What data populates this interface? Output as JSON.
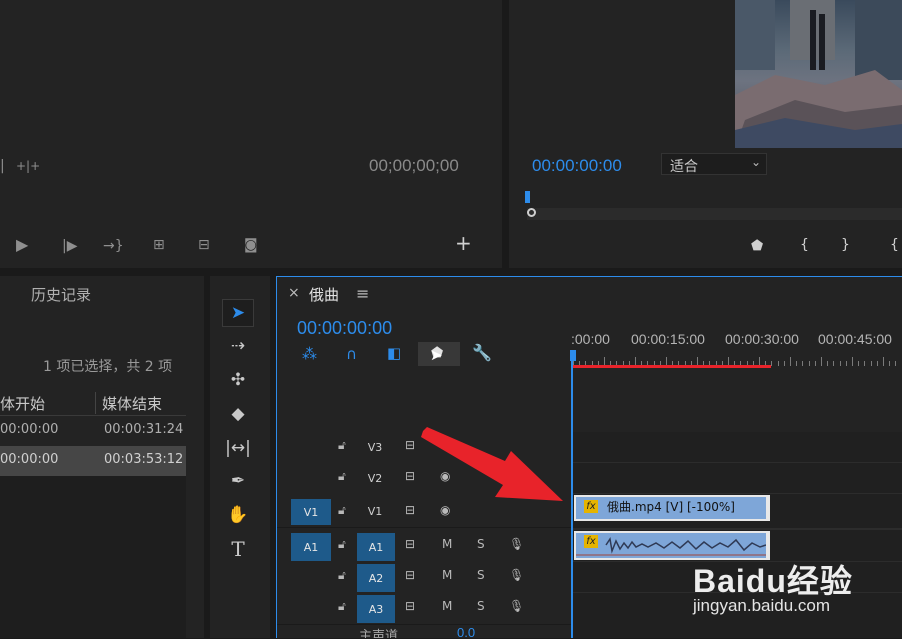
{
  "source_monitor": {
    "timecode": "00;00;00;00",
    "transport_icons": [
      "step-back-icon",
      "play-icon",
      "step-forward-icon",
      "go-to-out-icon",
      "insert-icon",
      "overwrite-icon",
      "export-frame-icon",
      "add-button-icon"
    ]
  },
  "program_monitor": {
    "timecode": "00:00:00:00",
    "fit_select": "适合",
    "marker_icons": [
      "marker-icon",
      "mark-in-icon",
      "mark-out-icon",
      "go-to-in-icon"
    ]
  },
  "project_panel": {
    "tab_history": "历史记录",
    "selection_status": "1 项已选择，共 2 项",
    "columns": [
      "体开始",
      "媒体结束"
    ],
    "rows": [
      {
        "start": "00:00:00",
        "end": "00:00:31:24"
      },
      {
        "start": "00:00:00",
        "end": "00:03:53:12"
      }
    ]
  },
  "tools": [
    "selection-tool",
    "track-select-tool",
    "ripple-edit-tool",
    "razor-tool",
    "slip-tool",
    "pen-tool",
    "hand-tool",
    "type-tool"
  ],
  "timeline": {
    "close": "×",
    "sequence_name": "俄曲",
    "menu": "≡",
    "timecode": "00:00:00:00",
    "ruler_labels": [
      ":00:00",
      "00:00:15:00",
      "00:00:30:00",
      "00:00:45:00"
    ],
    "tracks": [
      {
        "id": "V3",
        "target": "",
        "kind": "video",
        "visible": false
      },
      {
        "id": "V2",
        "target": "",
        "kind": "video",
        "visible": true
      },
      {
        "id": "V1",
        "target": "V1",
        "kind": "video",
        "visible": true
      },
      {
        "id": "A1",
        "target": "A1",
        "kind": "audio"
      },
      {
        "id": "A2",
        "target": "",
        "kind": "audio"
      },
      {
        "id": "A3",
        "target": "",
        "kind": "audio"
      }
    ],
    "mute_label": "M",
    "solo_label": "S",
    "master_label": "主声道",
    "master_value": "0.0",
    "video_clip": {
      "fx": "fx",
      "label": "俄曲.mp4 [V] [-100%]"
    },
    "audio_clip": {
      "fx": "fx"
    }
  },
  "watermark": {
    "brand": "Baidu经验",
    "url": "jingyan.baidu.com"
  },
  "colors": {
    "accent_blue": "#2d8ceb",
    "arrow_red": "#e8232a",
    "clip_blue": "#7ea6d8",
    "target_blue": "#1e5a8a"
  }
}
